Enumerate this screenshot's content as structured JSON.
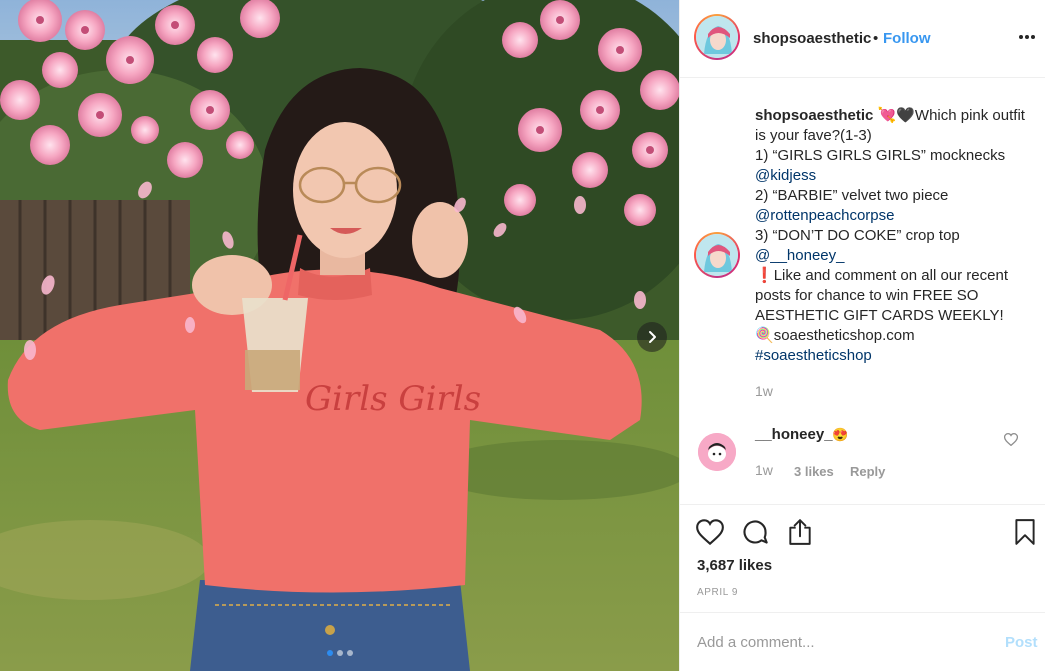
{
  "post": {
    "username": "shopsoaesthetic",
    "follow_separator": "•",
    "follow_label": "Follow",
    "caption": {
      "username": "shopsoaesthetic",
      "emojis": "💘🖤",
      "line1": "Which pink outfit is your fave?(1-3)",
      "item1": "1) “GIRLS GIRLS GIRLS” mocknecks",
      "mention1": "@kidjess",
      "item2": "2) “BARBIE” velvet two piece",
      "mention2": "@rottenpeachcorpse",
      "item3": "3) “DON’T DO COKE” crop top",
      "mention3": "@__honeey_",
      "exclaim": "❗",
      "promo": "Like and comment on all our recent posts for chance to win FREE SO AESTHETIC GIFT CARDS WEEKLY!",
      "lollipop": "🍭",
      "site": "soaestheticshop.com",
      "hashtag": "#soaestheticshop",
      "time": "1w"
    },
    "comment": {
      "username": "__honeey_",
      "emoji": "😍",
      "time": "1w",
      "likes": "3 likes",
      "reply": "Reply"
    },
    "likes_count": "3,687 likes",
    "date": "APRIL 9",
    "comment_placeholder": "Add a comment...",
    "post_label": "Post"
  },
  "media": {
    "sweater_text": "Girls Girls",
    "carousel_dots": 3,
    "active_dot": 1
  },
  "icons": {
    "more": "more-options-icon",
    "heart": "heart-icon",
    "comment": "comment-icon",
    "share": "share-icon",
    "save": "bookmark-icon",
    "next": "chevron-right-icon"
  },
  "colors": {
    "follow": "#3897f0",
    "link": "#003569",
    "muted": "#999999",
    "post_disabled": "#b2dffc",
    "sweater": "#f0716a"
  }
}
